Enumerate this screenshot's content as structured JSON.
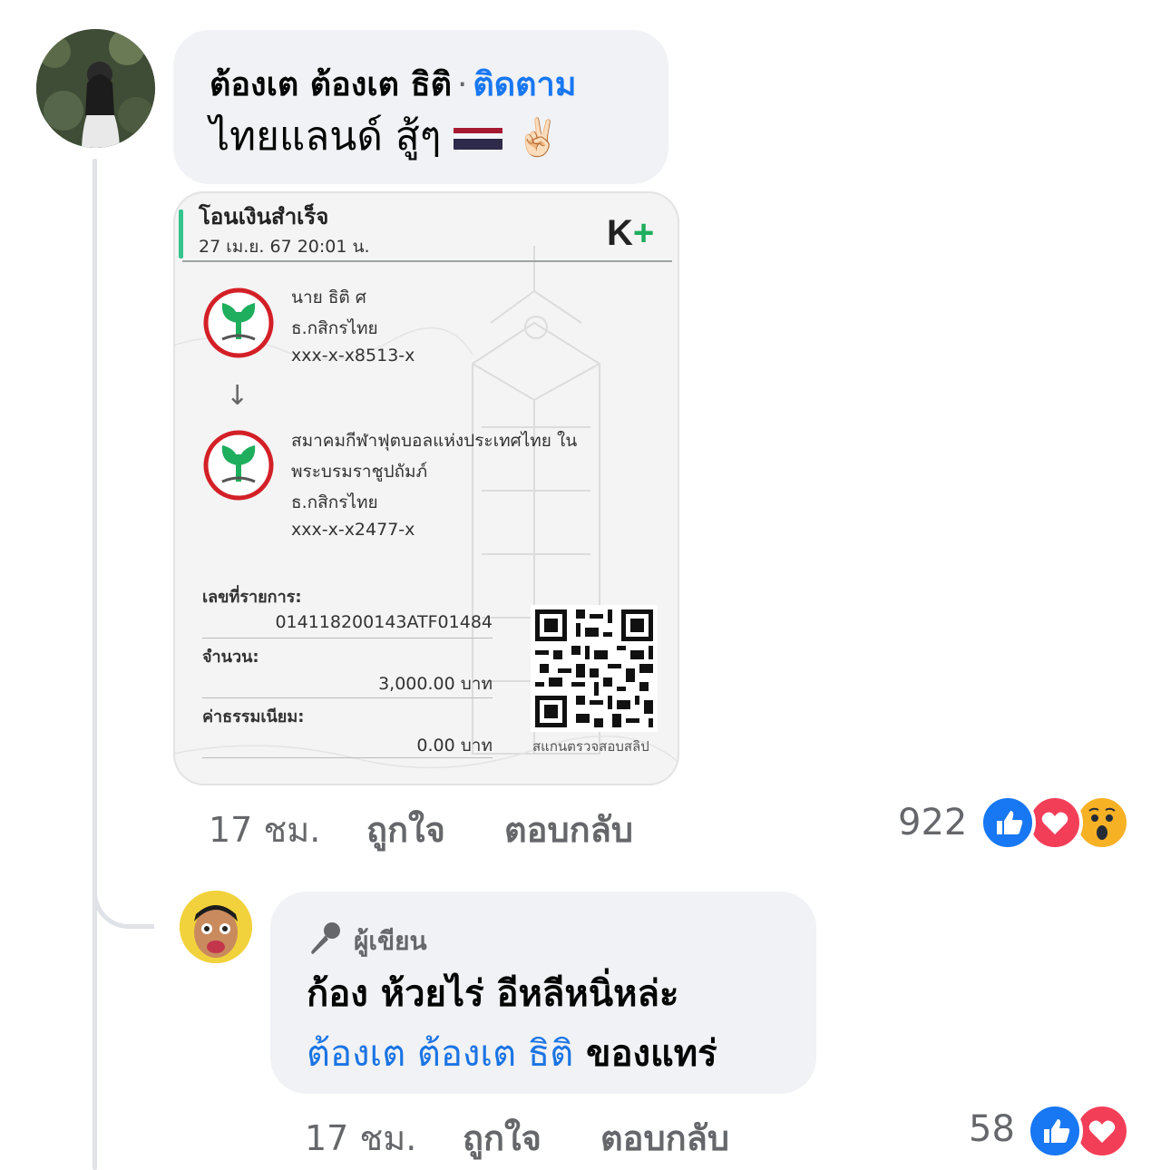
{
  "comment": {
    "author_name": "ต้องเต ต้องเต ธิติ",
    "separator": "·",
    "follow_label": "ติดตาม",
    "text": "ไทยแลนด์ สู้ๆ",
    "hand_emoji": "✌🏻",
    "time": "17 ชม.",
    "like_label": "ถูกใจ",
    "reply_label": "ตอบกลับ",
    "reaction_count": "922",
    "reactions": [
      "like-icon",
      "love-icon",
      "wow-icon"
    ]
  },
  "slip": {
    "title": "โอนเงินสำเร็จ",
    "date": "27 เม.ย. 67  20:01 น.",
    "brand": "K",
    "brand_plus": "+",
    "sender_name": "นาย ธิติ ศ",
    "sender_bank": "ธ.กสิกรไทย",
    "sender_account": "xxx-x-x8513-x",
    "arrow": "↓",
    "receiver_name_1": "สมาคมกีฬาฟุตบอลแห่งประเทศไทย ใน",
    "receiver_name_2": "พระบรมราชูปถัมภ์",
    "receiver_bank": "ธ.กสิกรไทย",
    "receiver_account": "xxx-x-x2477-x",
    "ref_label": "เลขที่รายการ:",
    "ref_value": "014118200143ATF01484",
    "amount_label": "จำนวน:",
    "amount_value": "3,000.00 บาท",
    "fee_label": "ค่าธรรมเนียม:",
    "fee_value": "0.00 บาท",
    "qr_caption": "สแกนตรวจสอบสลิป"
  },
  "reply": {
    "badge_label": "ผู้เขียน",
    "text_line1": "ก้อง ห้วยไร่ อีหลีหนิ่หล่ะ",
    "mention": "ต้องเต ต้องเต ธิติ",
    "text_line2_rest": " ของแทร่",
    "time": "17 ชม.",
    "like_label": "ถูกใจ",
    "reply_label": "ตอบกลับ",
    "reaction_count": "58",
    "reactions": [
      "like-icon",
      "love-icon"
    ]
  },
  "colors": {
    "link_blue": "#1877f2",
    "bubble_bg": "#f0f2f5",
    "meta_gray": "#65676b",
    "kbank_green": "#1fae5d"
  }
}
